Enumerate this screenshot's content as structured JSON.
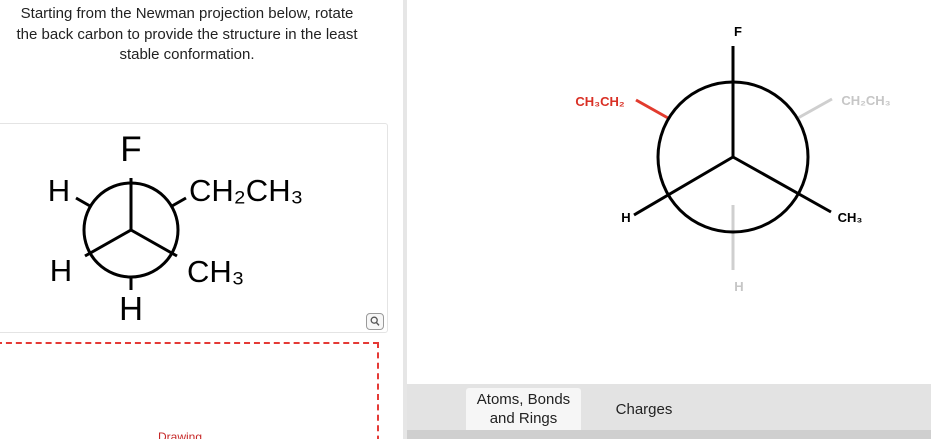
{
  "question": {
    "lines": [
      "Starting from the Newman projection below, rotate",
      "the back carbon to provide the structure in the least",
      "stable conformation."
    ]
  },
  "given_projection": {
    "front_top": "F",
    "front_left": "H",
    "front_right_top": "CH₂CH₃",
    "back_left": "H",
    "back_right": "CH₃",
    "back_bottom": "H"
  },
  "zoom_icon": "magnifier-icon",
  "drawing_area": {
    "label": "Drawing"
  },
  "editor": {
    "front_top": "F",
    "back_upper_left": "CH₃CH₂",
    "back_upper_right": "CH₂CH₃",
    "front_left": "H",
    "front_right": "CH₃",
    "back_bottom": "H",
    "colors": {
      "highlight_bond": "#e23b2e",
      "highlight_label": "#d93025",
      "ghost": "#cfcfcf",
      "ghost_label": "#c6c6c6",
      "ink": "#000000"
    }
  },
  "tabs": {
    "atoms_line1": "Atoms, Bonds",
    "atoms_line2": "and Rings",
    "charges": "Charges"
  }
}
